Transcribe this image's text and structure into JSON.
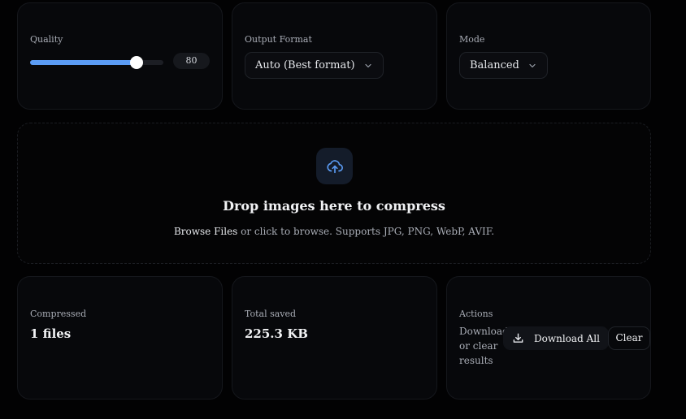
{
  "settings": {
    "quality": {
      "label": "Quality",
      "value": 80,
      "value_text": "80"
    },
    "output_format": {
      "label": "Output Format",
      "selected": "Auto (Best format)"
    },
    "mode": {
      "label": "Mode",
      "selected": "Balanced"
    }
  },
  "dropzone": {
    "icon": "cloud-upload-icon",
    "title": "Drop images here to compress",
    "browse_label": "Browse Files",
    "subtitle": " or click to browse. Supports JPG, PNG, WebP, AVIF."
  },
  "stats": {
    "compressed": {
      "label": "Compressed",
      "value": "1 files"
    },
    "saved": {
      "label": "Total saved",
      "value": "225.3 KB"
    }
  },
  "actions": {
    "label": "Actions",
    "hint": "Download or clear results",
    "download_all_label": "Download All",
    "clear_label": "Clear"
  },
  "colors": {
    "accent": "#5b9cf5",
    "background": "#020203",
    "card": "#07080b"
  }
}
